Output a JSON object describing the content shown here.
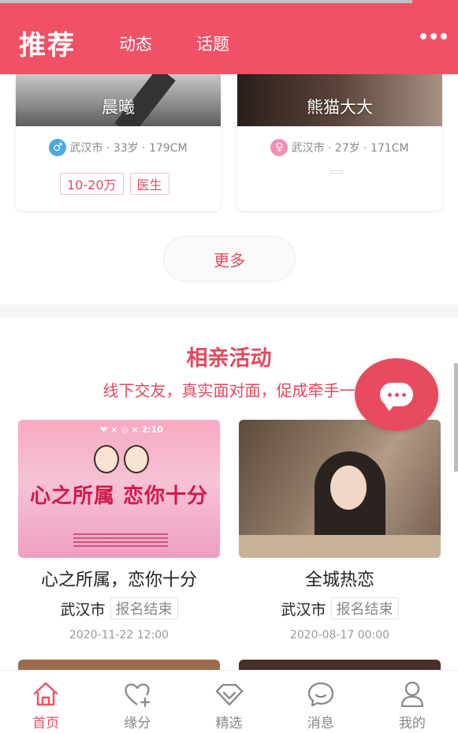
{
  "header": {
    "title": "推荐",
    "tabs": [
      {
        "label": "动态"
      },
      {
        "label": "话题"
      }
    ],
    "more_icon": "more-dots-icon"
  },
  "profiles": [
    {
      "name": "晨曦",
      "gender_icon": "male-icon",
      "info": "武汉市 · 33岁 · 179CM",
      "tags": [
        "10-20万",
        "医生"
      ]
    },
    {
      "name": "熊猫大大",
      "gender_icon": "female-icon",
      "info": "武汉市 · 27岁 · 171CM",
      "tags": []
    }
  ],
  "more_button": "更多",
  "events_section": {
    "title": "相亲活动",
    "subtitle": "线下交友，真实面对面，促成牵手一"
  },
  "events": [
    {
      "title": "心之所属，恋你十分",
      "city": "武汉市",
      "status": "报名结束",
      "date": "2020-11-22 12:00",
      "banner_text": "心之所属 恋你十分"
    },
    {
      "title": "全城热恋",
      "city": "武汉市",
      "status": "报名结束",
      "date": "2020-08-17 00:00"
    }
  ],
  "bottom_nav": [
    {
      "label": "首页",
      "icon": "home-icon",
      "active": true
    },
    {
      "label": "缘分",
      "icon": "heart-plus-icon",
      "active": false
    },
    {
      "label": "精选",
      "icon": "diamond-icon",
      "active": false
    },
    {
      "label": "消息",
      "icon": "chat-icon",
      "active": false
    },
    {
      "label": "我的",
      "icon": "user-icon",
      "active": false
    }
  ],
  "colors": {
    "brand": "#f05167",
    "accent": "#e6485d"
  }
}
